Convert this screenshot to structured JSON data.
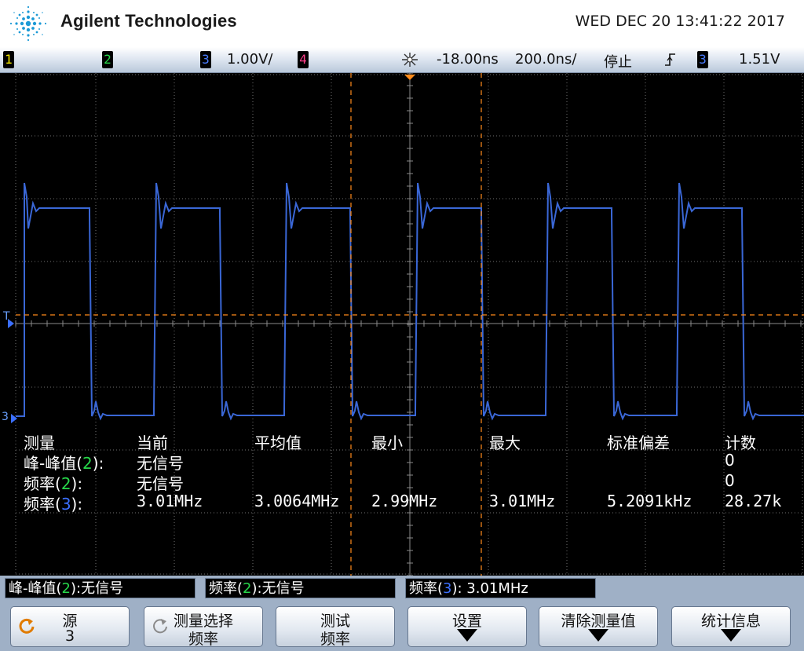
{
  "header": {
    "brand": "Agilent Technologies",
    "datetime": "WED DEC 20 13:41:22 2017"
  },
  "statusbar": {
    "channels": [
      {
        "label": "1",
        "color": "#f2e600"
      },
      {
        "label": "2",
        "color": "#27d84a"
      },
      {
        "label": "3",
        "color": "#3b6fff"
      },
      {
        "label": "4",
        "color": "#ff3f8a"
      }
    ],
    "ch3_scale": "1.00V/",
    "trigger_icon": "trigger-position-icon",
    "delay": "-18.00ns",
    "timebase": "200.0ns/",
    "run_state": "停止",
    "slope_icon": "rising-edge-icon",
    "trigger_source": "3",
    "trigger_level": "1.51V"
  },
  "screen": {
    "trigger_marker": "T",
    "ch3_marker": "3"
  },
  "measurements": {
    "headers": [
      "测量",
      "当前",
      "平均值",
      "最小",
      "最大",
      "标准偏差",
      "计数"
    ],
    "rows": [
      {
        "name_pre": "峰-峰值(",
        "ch": "2",
        "name_post": "):",
        "current": "无信号",
        "mean": "",
        "min": "",
        "max": "",
        "std": "",
        "count": "0"
      },
      {
        "name_pre": "频率(",
        "ch": "2",
        "name_post": "):",
        "current": "无信号",
        "mean": "",
        "min": "",
        "max": "",
        "std": "",
        "count": "0"
      },
      {
        "name_pre": "频率(",
        "ch": "3",
        "name_post": "):",
        "current": "3.01MHz",
        "mean": "3.0064MHz",
        "min": "2.99MHz",
        "max": "3.01MHz",
        "std": "5.2091kHz",
        "count": "28.27k"
      }
    ]
  },
  "infobar": [
    {
      "pre": "峰-峰值(",
      "ch": "2",
      "post": "):无信号"
    },
    {
      "pre": "频率(",
      "ch": "2",
      "post": "):无信号"
    },
    {
      "pre": "频率(",
      "ch": "3",
      "post": "): 3.01MHz"
    }
  ],
  "softkeys": [
    {
      "line1": "源",
      "line2": "3",
      "icon": "cycle-icon"
    },
    {
      "line1": "测量选择",
      "line2": "频率",
      "icon": "cycle-icon"
    },
    {
      "line1": "测试",
      "line2": "频率",
      "icon": ""
    },
    {
      "line1": "设置",
      "line2": "",
      "icon": "down-arrow-icon"
    },
    {
      "line1": "清除测量值",
      "line2": "",
      "icon": "down-arrow-icon"
    },
    {
      "line1": "统计信息",
      "line2": "",
      "icon": "down-arrow-icon"
    }
  ],
  "colors": {
    "ch2": "#27d84a",
    "ch3": "#3b6fff",
    "trace": "#3a67d6",
    "marker": "#ff8a1a",
    "grid": "#6f6f6f"
  }
}
